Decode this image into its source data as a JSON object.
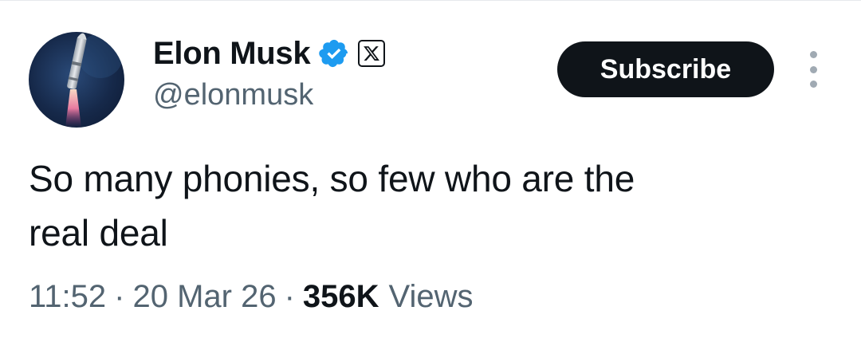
{
  "author": {
    "display_name": "Elon Musk",
    "handle": "@elonmusk",
    "verified_icon": "verified-badge-icon",
    "affiliation_icon": "x-logo-icon",
    "verified_color": "#1d9bf0"
  },
  "actions": {
    "subscribe_label": "Subscribe",
    "more_icon": "more-vertical-icon"
  },
  "tweet": {
    "text_line1": "So many phonies, so few who are the",
    "text_line2": "real deal"
  },
  "meta": {
    "time": "11:52",
    "separator": "·",
    "date": "20 Mar 26",
    "views_count": "356K",
    "views_label": "Views"
  },
  "colors": {
    "text_primary": "#0f1419",
    "text_secondary": "#536471",
    "button_bg": "#0f1419"
  }
}
